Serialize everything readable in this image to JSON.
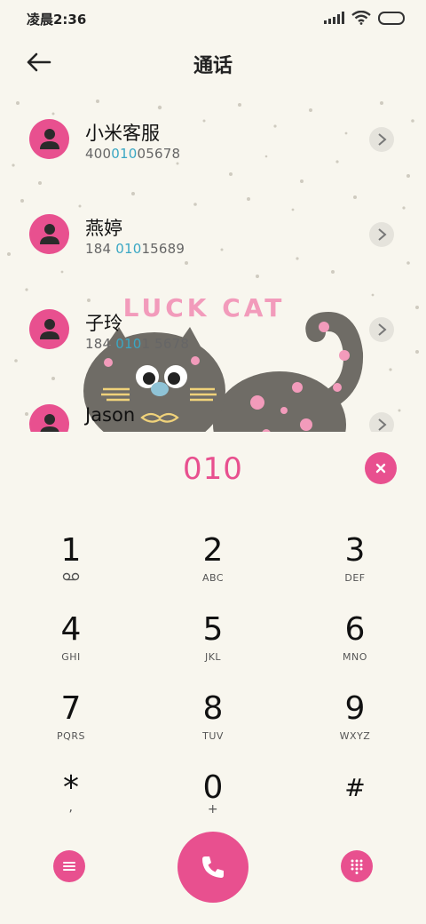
{
  "status": {
    "time": "凌晨2:36"
  },
  "header": {
    "title": "通话"
  },
  "contacts": [
    {
      "name": "小米客服",
      "num_pre": "400",
      "num_hl": "010",
      "num_post": "05678"
    },
    {
      "name": "燕婷",
      "num_pre": "184 ",
      "num_hl": "010",
      "num_post": "15689"
    },
    {
      "name": "子玲",
      "num_pre": "184 ",
      "num_hl": "010",
      "num_post": "1 5678"
    },
    {
      "name": "Jason",
      "num_pre": "",
      "num_hl": "",
      "num_post": ""
    }
  ],
  "wallpaper": {
    "caption": "LUCK CAT"
  },
  "dial": {
    "value": "010"
  },
  "keys": [
    {
      "digit": "1",
      "letters": ""
    },
    {
      "digit": "2",
      "letters": "ABC"
    },
    {
      "digit": "3",
      "letters": "DEF"
    },
    {
      "digit": "4",
      "letters": "GHI"
    },
    {
      "digit": "5",
      "letters": "JKL"
    },
    {
      "digit": "6",
      "letters": "MNO"
    },
    {
      "digit": "7",
      "letters": "PQRS"
    },
    {
      "digit": "8",
      "letters": "TUV"
    },
    {
      "digit": "9",
      "letters": "WXYZ"
    },
    {
      "digit": "*",
      "letters": ","
    },
    {
      "digit": "0",
      "letters": "+"
    },
    {
      "digit": "#",
      "letters": ""
    }
  ],
  "icons": {
    "back": "back-arrow-icon",
    "voicemail": "voicemail-icon",
    "menu": "menu-icon",
    "call": "phone-icon",
    "keypad": "dialpad-icon",
    "clear": "close-icon",
    "detail": "chevron-right-icon"
  },
  "colors": {
    "accent": "#e8508f",
    "highlight": "#3aa7c4",
    "background": "#f8f6ee"
  }
}
